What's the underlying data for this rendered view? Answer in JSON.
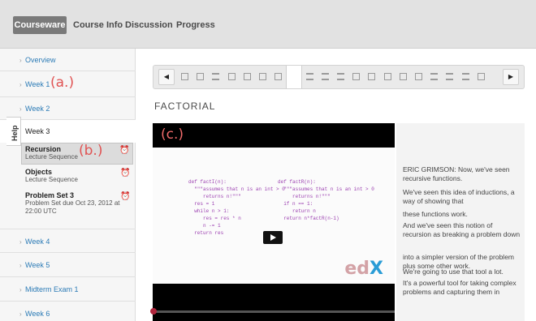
{
  "tabs": [
    "Courseware",
    "Course Info",
    "Discussion",
    "Progress"
  ],
  "sidebar": {
    "items": [
      {
        "label": "Overview"
      },
      {
        "label": "Week 1"
      },
      {
        "label": "Week 2"
      },
      {
        "label": "Week 3"
      },
      {
        "label": "Week 4"
      },
      {
        "label": "Week 5"
      },
      {
        "label": "Midterm Exam 1"
      },
      {
        "label": "Week 6"
      }
    ],
    "week3_subsections": [
      {
        "title": "Recursion",
        "subtitle": "Lecture Sequence"
      },
      {
        "title": "Objects",
        "subtitle": "Lecture Sequence"
      },
      {
        "title": "Problem Set 3",
        "subtitle": "Problem Set due Oct 23, 2012 at",
        "subtitle2": "22:00 UTC"
      }
    ],
    "help_label": "Help"
  },
  "annotations": {
    "a": "(a.)",
    "b": "(b.)",
    "c": "(c.)"
  },
  "unit_title": "FACTORIAL",
  "sequence": {
    "items": [
      "video",
      "video",
      "list",
      "video",
      "video",
      "video",
      "video",
      "list",
      "list",
      "list",
      "list",
      "video",
      "video",
      "video",
      "video",
      "video",
      "list",
      "list",
      "list",
      "video"
    ],
    "active_index": 7
  },
  "video": {
    "code_left": [
      "def factI(n):",
      "  \"\"\"assumes that n is an int > 0",
      "     returns n!\"\"\"",
      "  res = 1",
      "  while n > 1:",
      "     res = res * n",
      "     n -= 1",
      "  return res"
    ],
    "code_right": [
      "def factR(n):",
      "  \"\"\"assumes that n is an int > 0",
      "     returns n!\"\"\"",
      "  if n == 1:",
      "     return n",
      "  return n*factR(n-1)"
    ],
    "logo_e": "ed",
    "logo_x": "X"
  },
  "transcript": [
    "ERIC GRIMSON: Now, we've seen recursive functions.",
    "We've seen this idea of inductions, a way of showing that",
    "these functions work.",
    "And we've seen this notion of recursion as breaking a problem down",
    "into a simpler version of the problem plus some other work.",
    "We're going to use that tool a lot.",
    "It's a powerful tool for taking complex problems and capturing them in"
  ],
  "colors": {
    "accent": "#2c7bb6",
    "annotation": "#e05353",
    "alarm": "#3aa2d8"
  }
}
